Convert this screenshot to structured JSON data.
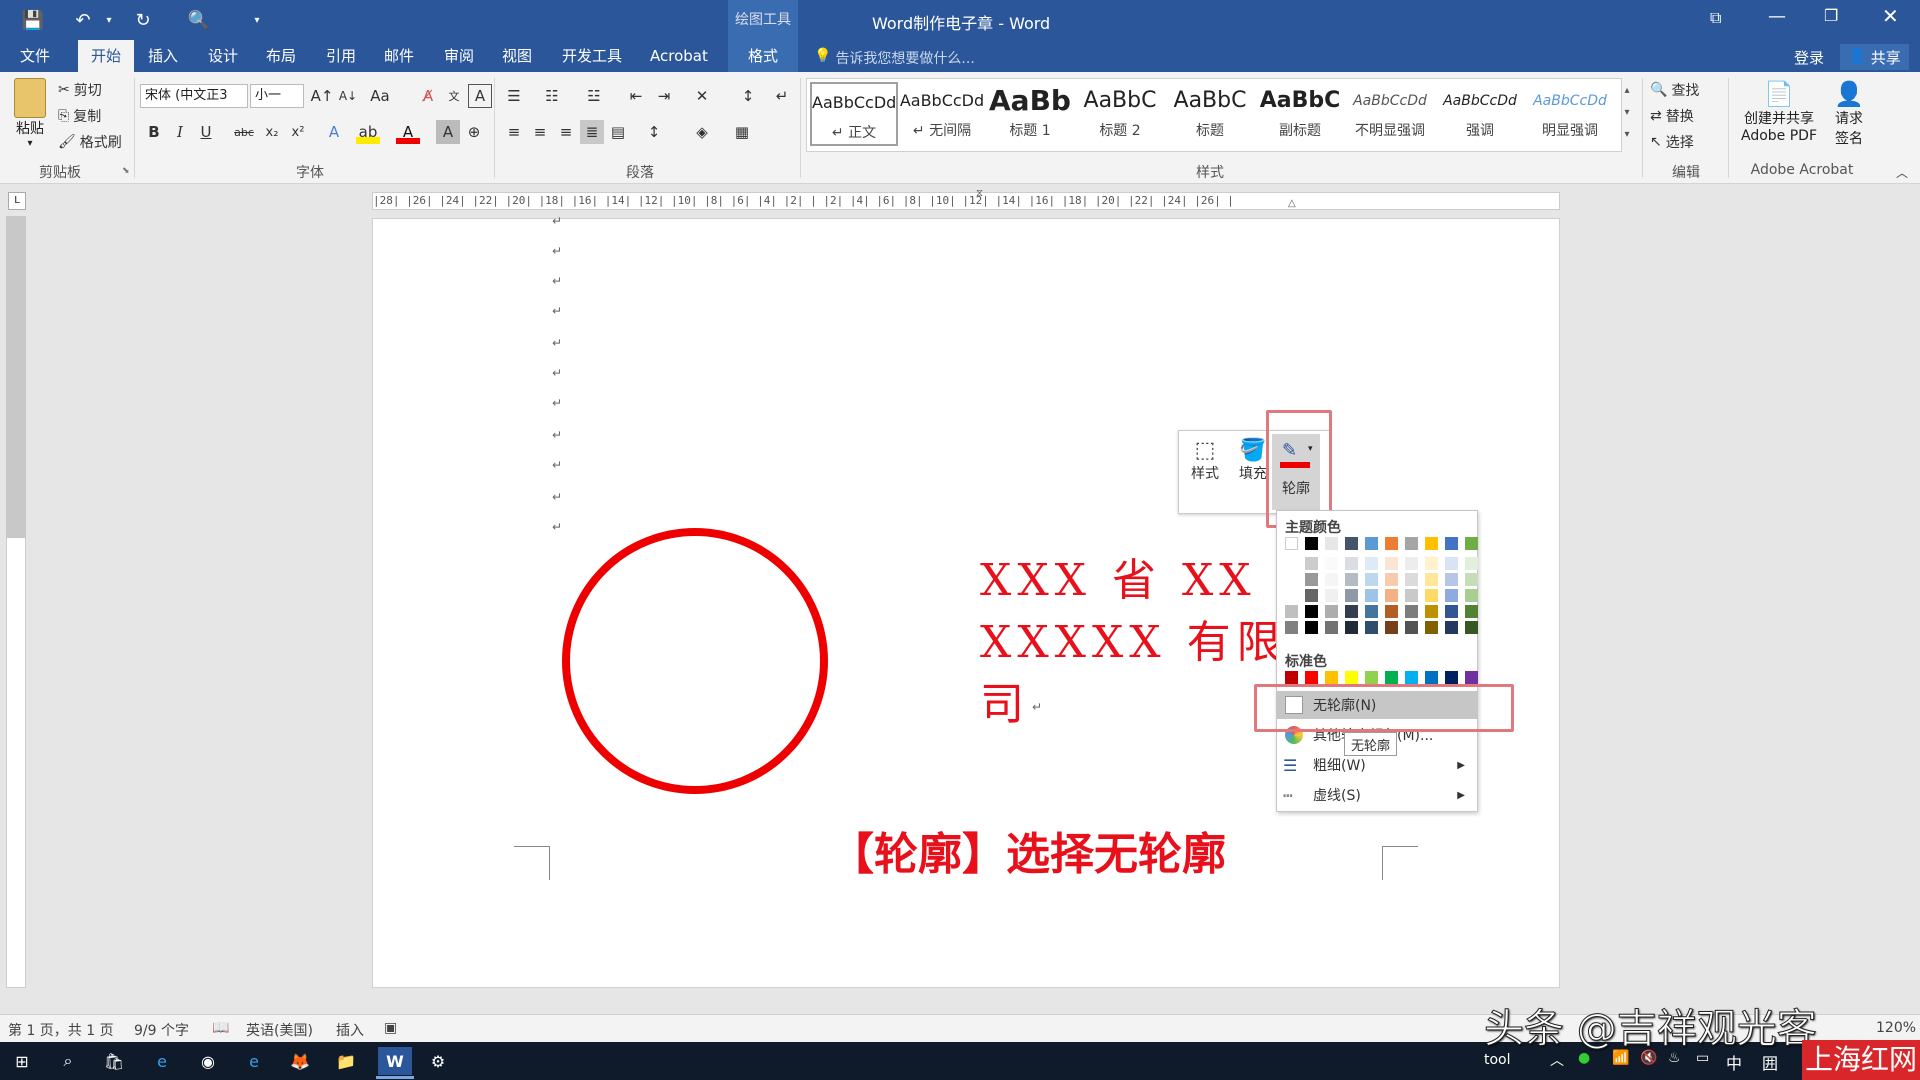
{
  "titlebar": {
    "contextual_tab_group": "绘图工具",
    "document_title": "Word制作电子章 - Word",
    "window_buttons": [
      "restore-ribbon-icon",
      "minimize-icon",
      "restore-icon",
      "close-icon"
    ]
  },
  "tabs": {
    "items": [
      "文件",
      "开始",
      "插入",
      "设计",
      "布局",
      "引用",
      "邮件",
      "审阅",
      "视图",
      "开发工具",
      "Acrobat"
    ],
    "contextual": "格式",
    "active": "开始",
    "tell_me": "告诉我您想要做什么...",
    "login": "登录",
    "share": "共享"
  },
  "ribbon": {
    "clipboard": {
      "paste": "粘贴",
      "cut": "剪切",
      "copy": "复制",
      "format_painter": "格式刷",
      "label": "剪贴板"
    },
    "font": {
      "name": "宋体 (中文正3",
      "size": "小一",
      "label": "字体",
      "bold": "B",
      "italic": "I",
      "underline": "U",
      "strike": "abc",
      "sub": "x₂",
      "sup": "x²"
    },
    "paragraph": {
      "label": "段落"
    },
    "styles": {
      "label": "样式",
      "items": [
        {
          "preview": "AaBbCcDd",
          "name": "↵ 正文"
        },
        {
          "preview": "AaBbCcDd",
          "name": "↵ 无间隔"
        },
        {
          "preview": "AaBb",
          "name": "标题 1"
        },
        {
          "preview": "AaBbC",
          "name": "标题 2"
        },
        {
          "preview": "AaBbC",
          "name": "标题"
        },
        {
          "preview": "AaBbC",
          "name": "副标题"
        },
        {
          "preview": "AaBbCcDd",
          "name": "不明显强调"
        },
        {
          "preview": "AaBbCcDd",
          "name": "强调"
        },
        {
          "preview": "AaBbCcDd",
          "name": "明显强调"
        }
      ]
    },
    "editing": {
      "find": "查找",
      "replace": "替换",
      "select": "选择",
      "label": "编辑"
    },
    "acrobat": {
      "create_share": "创建并共享",
      "adobe_pdf": "Adobe PDF",
      "request": "请求",
      "sign": "签名",
      "label": "Adobe Acrobat"
    }
  },
  "ruler": {
    "horizontal": "|28| |26| |24| |22| |20| |18| |16| |14| |12| |10| |8| |6| |4| |2| |  |2| |4| |6| |8| |10| |12| |14| |16| |18| |20| |22| |24| |26| |"
  },
  "document": {
    "text_line1": "XXX 省 XX 市",
    "text_line2": "XXXXX 有限公",
    "text_line3": "司",
    "banner": "【轮廓】选择无轮廓",
    "para_mark": "↵",
    "seal_color": "#e00000"
  },
  "mini_toolbar": {
    "style": "样式",
    "fill": "填充",
    "outline": "轮廓"
  },
  "outline_menu": {
    "theme_colors_label": "主题颜色",
    "standard_colors_label": "标准色",
    "theme_colors": [
      "#ffffff",
      "#000000",
      "#e7e6e6",
      "#44546a",
      "#5b9bd5",
      "#ed7d31",
      "#a5a5a5",
      "#ffc000",
      "#4472c4",
      "#70ad47"
    ],
    "standard_colors": [
      "#c00000",
      "#ff0000",
      "#ffc000",
      "#ffff00",
      "#92d050",
      "#00b050",
      "#00b0f0",
      "#0070c0",
      "#002060",
      "#7030a0"
    ],
    "no_outline": "无轮廓(N)",
    "more_colors": "其他轮廓颜色(M)...",
    "tooltip": "无轮廓",
    "weight": "粗细(W)",
    "dashes": "虚线(S)",
    "highlight_color": "#e0797e"
  },
  "statusbar": {
    "page": "第 1 页，共 1 页",
    "words": "9/9 个字",
    "language": "英语(美国)",
    "mode": "插入",
    "zoom": "120%"
  },
  "taskbar": {
    "tray_text": "tool",
    "ime": "中",
    "time": "1"
  },
  "watermark": {
    "text": "头条 @吉祥观光客",
    "badge": "上海红网"
  }
}
